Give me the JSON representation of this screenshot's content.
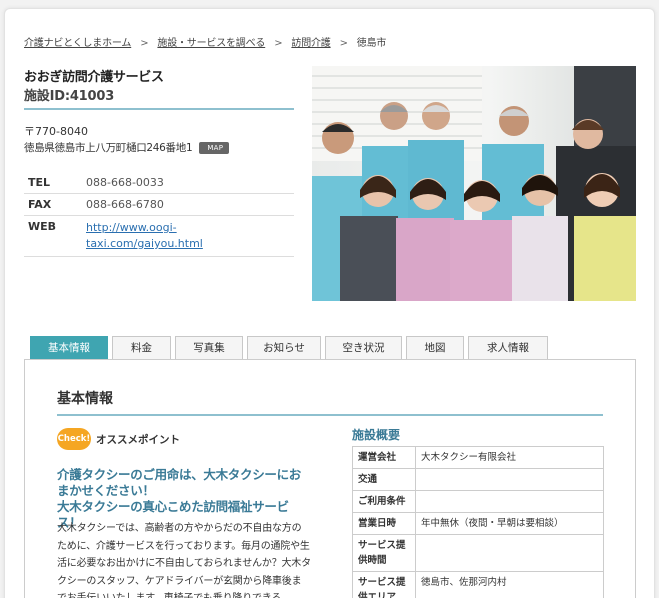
{
  "breadcrumb": {
    "items": [
      "介護ナビとくしまホーム",
      "施設・サービスを調べる",
      "訪問介護"
    ],
    "current": "徳島市",
    "separator": ">"
  },
  "facility": {
    "name": "おおぎ訪問介護サービス",
    "id_label": "施設ID:41003",
    "postal": "〒770-8040",
    "address": "徳島県徳島市上八万町樋口246番地1",
    "map_label": "MAP"
  },
  "contact": [
    {
      "key": "TEL",
      "value": "088-668-0033"
    },
    {
      "key": "FAX",
      "value": "088-668-6780"
    },
    {
      "key": "WEB",
      "value": "http://www.oogi-taxi.com/gaiyou.html"
    }
  ],
  "tabs": [
    {
      "label": "基本情報",
      "active": true
    },
    {
      "label": "料金",
      "active": false
    },
    {
      "label": "写真集",
      "active": false
    },
    {
      "label": "お知らせ",
      "active": false
    },
    {
      "label": "空き状況",
      "active": false
    },
    {
      "label": "地図",
      "active": false
    },
    {
      "label": "求人情報",
      "active": false
    }
  ],
  "section": {
    "title": "基本情報",
    "check_badge": "Check!",
    "check_label": "オススメポイント",
    "catch_line1": "介護タクシーのご用命は、大木タクシーにおまかせください！",
    "catch_line2": "大木タクシーの真心こめた訪問福祉サービス！",
    "description": "大木タクシーでは、高齢者の方やからだの不自由な方のために、介護サービスを行っております。毎月の通院や生活に必要なお出かけに不自由しておられませんか？大木タクシーのスタッフ、ケアドライバーが玄関から降車後までお手伝いいたします。車椅子でも乗り降りできる"
  },
  "overview": {
    "title": "施設概要",
    "rows": [
      {
        "key": "運営会社",
        "value": "大木タクシー有限会社"
      },
      {
        "key": "交通",
        "value": ""
      },
      {
        "key": "ご利用条件",
        "value": ""
      },
      {
        "key": "営業日時",
        "value": "年中無休（夜間・早朝は要相談）"
      },
      {
        "key": "サービス提供時間",
        "value": ""
      },
      {
        "key": "サービス提供エリア",
        "value": "徳島市、佐那河内村"
      }
    ]
  },
  "colors": {
    "accent": "#3fa5b1",
    "rule": "#8ec0cf",
    "heading": "#3a7a96",
    "check": "#f5a623",
    "link": "#2a6fb0"
  }
}
